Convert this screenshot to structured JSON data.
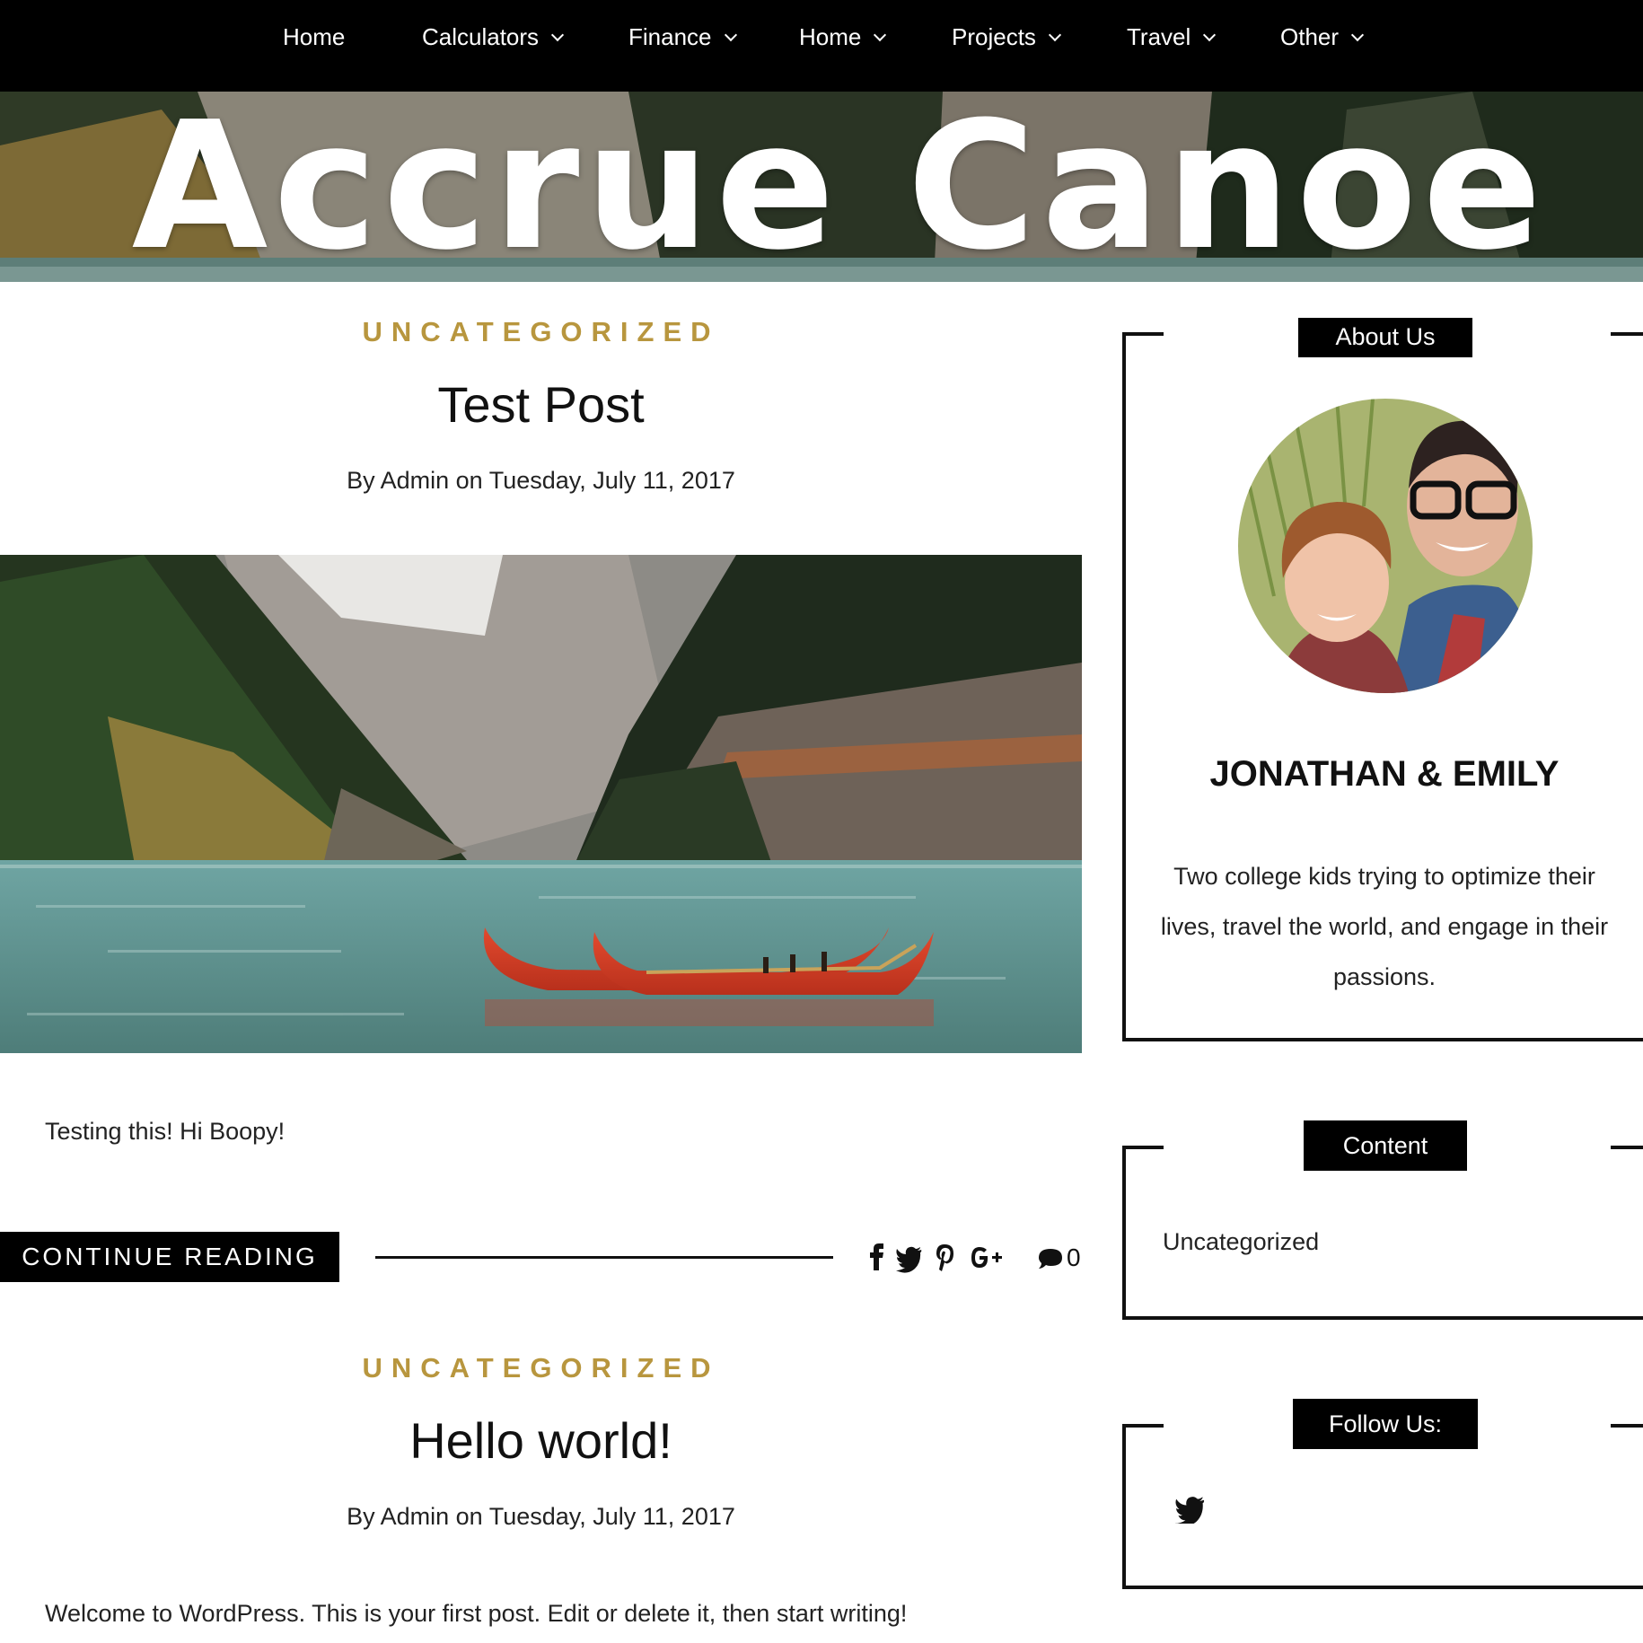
{
  "nav": {
    "items": [
      {
        "label": "Home",
        "dropdown": false
      },
      {
        "label": "Calculators",
        "dropdown": true
      },
      {
        "label": "Finance",
        "dropdown": true
      },
      {
        "label": "Home",
        "dropdown": true
      },
      {
        "label": "Projects",
        "dropdown": true
      },
      {
        "label": "Travel",
        "dropdown": true
      },
      {
        "label": "Other",
        "dropdown": true
      }
    ]
  },
  "site": {
    "title": "Accrue Canoe"
  },
  "posts": [
    {
      "category": "UNCATEGORIZED",
      "title": "Test Post",
      "meta": "By Admin on Tuesday, July 11, 2017",
      "excerpt": "Testing this! Hi Boopy!",
      "continue_label": "CONTINUE READING",
      "comment_count": "0",
      "share_icons": [
        "facebook-icon",
        "twitter-icon",
        "pinterest-icon",
        "google-plus-icon"
      ]
    },
    {
      "category": "UNCATEGORIZED",
      "title": "Hello world!",
      "meta": "By Admin on Tuesday, July 11, 2017",
      "excerpt": "Welcome to WordPress. This is your first post. Edit or delete it, then start writing!"
    }
  ],
  "sidebar": {
    "about": {
      "title": "About Us",
      "name": "JONATHAN & EMILY",
      "text": "Two college kids trying to optimize their lives, travel the world, and engage in their passions."
    },
    "content": {
      "title": "Content",
      "links": [
        "Uncategorized"
      ]
    },
    "follow": {
      "title": "Follow Us:",
      "icons": [
        "twitter-icon"
      ]
    }
  },
  "colors": {
    "accent": "#b8963e",
    "nav_bg": "#000000",
    "canoe": "#d9422a"
  }
}
